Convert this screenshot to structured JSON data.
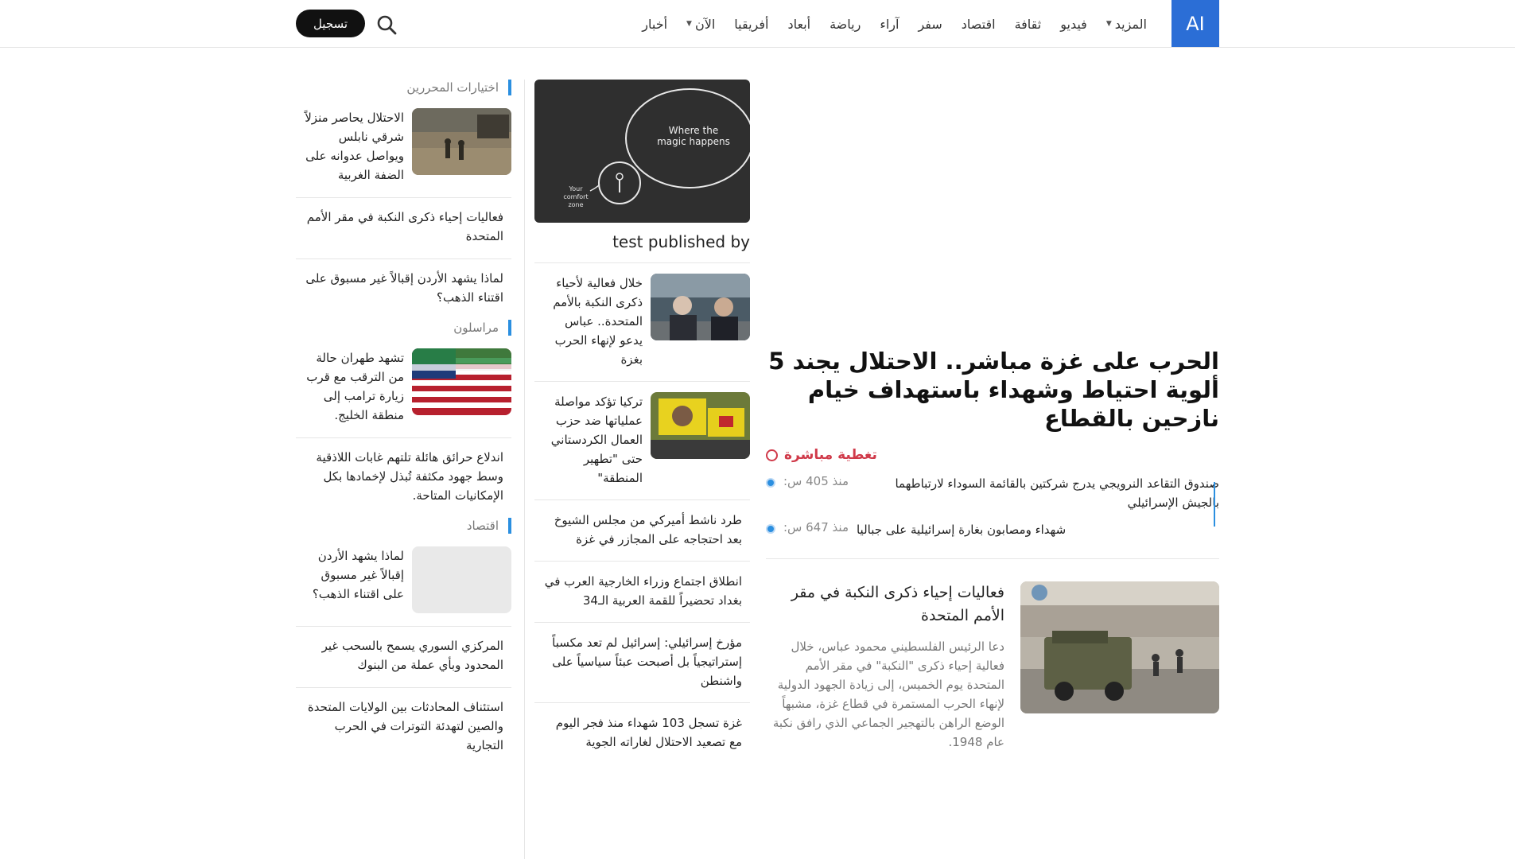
{
  "brand": {
    "logo_text": "AI"
  },
  "nav": {
    "items": [
      "أخبار",
      "الآن",
      "أفريقيا",
      "أبعاد",
      "رياضة",
      "آراء",
      "سفر",
      "اقتصاد",
      "ثقافة",
      "فيديو",
      "المزيد"
    ],
    "register_label": "تسجيل"
  },
  "left": {
    "editors_title": "اختيارات المحررين",
    "editors": [
      "الاحتلال يحاصر منزلاً شرقي نابلس ويواصل عدوانه على الضفة الغربية",
      "فعاليات إحياء ذكرى النكبة في مقر الأمم المتحدة",
      "لماذا يشهد الأردن إقبالاً غير مسبوق على اقتناء الذهب؟"
    ],
    "correspondents_title": "مراسلون",
    "correspondents": [
      "تشهد طهران حالة من الترقب مع قرب زيارة ترامب إلى منطقة الخليج.",
      "اندلاع حرائق هائلة تلتهم غابات اللاذقية وسط جهود مكثفة تُبذل لإخمادها بكل الإمكانيات المتاحة."
    ],
    "economy_title": "اقتصاد",
    "economy": [
      "لماذا يشهد الأردن إقبالاً غير مسبوق على اقتناء الذهب؟",
      "المركزي السوري يسمح بالسحب غير المحدود وبأي عملة من البنوك",
      "استئناف المحادثات بين الولايات المتحدة والصين لتهدئة التوترات في الحرب التجارية"
    ]
  },
  "middle": {
    "feature_image_text_1": "Where the",
    "feature_image_text_2": "magic happens",
    "feature_image_text_3": "Your",
    "feature_image_text_4": "comfort",
    "feature_image_text_5": "zone",
    "feature_caption": "test published by",
    "items": [
      "خلال فعالية لأحياء ذكرى النكبة بالأمم المتحدة.. عباس يدعو لإنهاء الحرب بغزة",
      "تركيا تؤكد مواصلة عملياتها ضد حزب العمال الكردستاني حتى \"تطهير المنطقة\"",
      "طرد ناشط أميركي من مجلس الشيوخ بعد احتجاجه على المجازر في غزة",
      "انطلاق اجتماع وزراء الخارجية العرب في بغداد تحضيراً للقمة العربية الـ34",
      "مؤرخ إسرائيلي: إسرائيل لم تعد مكسباً إستراتيجياً بل أصبحت عبئاً سياسياً على واشنطن",
      "غزة تسجل 103 شهداء منذ فجر اليوم مع تصعيد الاحتلال لغاراته الجوية"
    ]
  },
  "main": {
    "headline": "الحرب على غزة مباشر.. الاحتلال يجند 5 ألوية احتياط وشهداء باستهداف خيام نازحين بالقطاع",
    "live_label": "تغطية مباشرة",
    "updates": [
      {
        "time": "منذ 405 س:",
        "text": "صندوق التقاعد النرويجي يدرج شركتين بالقائمة السوداء لارتباطهما بالجيش الإسرائيلي"
      },
      {
        "time": "منذ 647 س:",
        "text": "شهداء ومصابون بغارة إسرائيلية على جباليا"
      }
    ],
    "story_title": "فعاليات إحياء ذكرى النكبة في مقر الأمم المتحدة",
    "story_summary": "دعا الرئيس الفلسطيني محمود عباس، خلال فعالية إحياء ذكرى \"النكبة\" في مقر الأمم المتحدة يوم الخميس، إلى زيادة الجهود الدولية لإنهاء الحرب المستمرة في قطاع غزة، مشبهاً الوضع الراهن بالتهجير الجماعي الذي رافق نكبة عام 1948."
  },
  "colors": {
    "accent": "#2b8fe0",
    "logo_bg": "#2b6ed6",
    "live": "#d03a4a",
    "button_bg": "#111111"
  }
}
